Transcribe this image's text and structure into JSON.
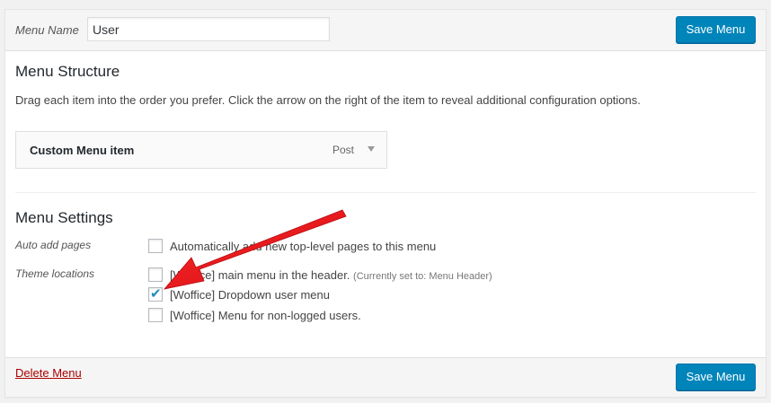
{
  "header": {
    "menu_name_label": "Menu Name",
    "menu_name_value": "User",
    "save_label": "Save Menu"
  },
  "structure": {
    "title": "Menu Structure",
    "instructions": "Drag each item into the order you prefer. Click the arrow on the right of the item to reveal additional configuration options.",
    "items": [
      {
        "title": "Custom Menu item",
        "type": "Post"
      }
    ]
  },
  "settings": {
    "title": "Menu Settings",
    "auto_add": {
      "label": "Auto add pages",
      "option": "Automatically add new top-level pages to this menu",
      "checked": false
    },
    "theme_locations": {
      "label": "Theme locations",
      "options": [
        {
          "text": "[Woffice] main menu in the header.",
          "note": "(Currently set to: Menu Header)",
          "checked": false
        },
        {
          "text": "[Woffice] Dropdown user menu",
          "checked": true
        },
        {
          "text": "[Woffice] Menu for non-logged users.",
          "checked": false
        }
      ]
    }
  },
  "footer": {
    "delete_label": "Delete Menu",
    "save_label": "Save Menu"
  },
  "colors": {
    "primary_button": "#0085ba",
    "delete_link": "#a00",
    "annotation_arrow": "#e8141b",
    "checkmark": "#1e8cbe"
  }
}
